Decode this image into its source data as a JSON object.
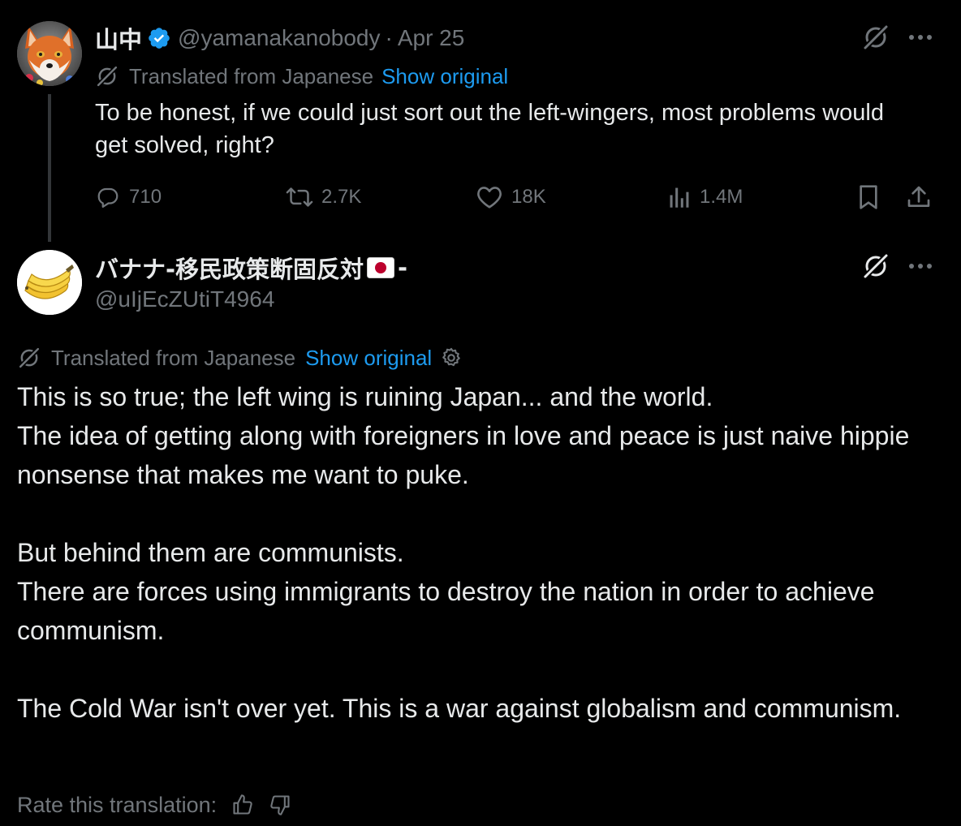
{
  "tweet1": {
    "display_name": "山中",
    "handle": "@yamanakanobody",
    "separator": "·",
    "date": "Apr 25",
    "translated_label": "Translated from Japanese",
    "show_original": "Show original",
    "text": "To be honest, if we could just sort out the left-wingers, most problems would get solved, right?",
    "stats": {
      "replies": "710",
      "reposts": "2.7K",
      "likes": "18K",
      "views": "1.4M"
    }
  },
  "tweet2": {
    "display_name_prefix": "バナナ-移民政策断固反対",
    "display_name_suffix": "-",
    "handle": "@uIjEcZUtiT4964",
    "translated_label": "Translated from Japanese",
    "show_original": "Show original",
    "paragraphs": [
      [
        "This is so true; the left wing is ruining Japan... and the world.",
        "The idea of getting along with foreigners in love and peace is just naive hippie nonsense that makes me want to puke."
      ],
      [
        "But behind them are communists.",
        "There are forces using immigrants to destroy the nation in order to achieve communism."
      ],
      [
        "The Cold War isn't over yet. This is a war against globalism and communism."
      ]
    ],
    "rate_label": "Rate this translation:"
  },
  "colors": {
    "background": "#000000",
    "text": "#e7e9ea",
    "muted": "#71767b",
    "link": "#1d9bf0",
    "verified": "#1d9bf0",
    "thread_line": "#333639"
  },
  "icons": [
    "verified-badge-icon",
    "grok-icon",
    "more-icon",
    "translate-icon",
    "reply-icon",
    "repost-icon",
    "like-icon",
    "views-icon",
    "bookmark-icon",
    "share-icon",
    "gear-icon",
    "thumbs-up-icon",
    "thumbs-down-icon",
    "japan-flag-icon",
    "fox-avatar",
    "banana-avatar"
  ]
}
